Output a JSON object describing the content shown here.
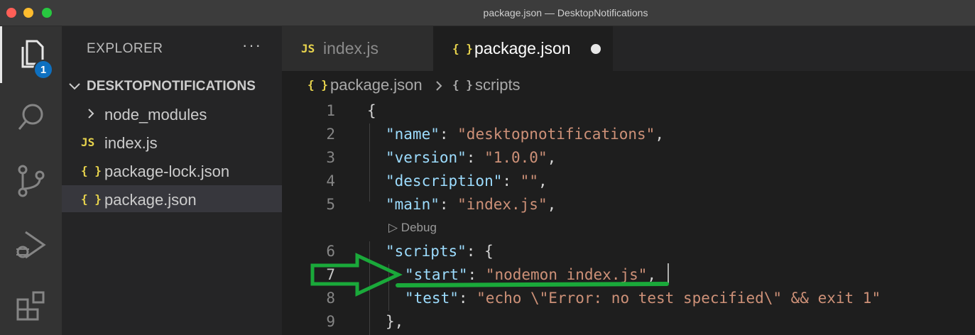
{
  "window": {
    "title": "package.json — DesktopNotifications"
  },
  "activity_bar": {
    "explorer_badge": "1"
  },
  "sidebar": {
    "header": "EXPLORER",
    "more": "···",
    "folder": "DESKTOPNOTIFICATIONS",
    "items": [
      {
        "icon": "JS",
        "label": "node_modules"
      },
      {
        "icon": "JS",
        "label": "index.js"
      },
      {
        "icon": "{ }",
        "label": "package-lock.json"
      },
      {
        "icon": "{ }",
        "label": "package.json"
      }
    ]
  },
  "tabs": [
    {
      "icon": "JS",
      "label": "index.js"
    },
    {
      "icon": "{ }",
      "label": "package.json"
    }
  ],
  "breadcrumb": {
    "icon1": "{ }",
    "file": "package.json",
    "icon2": "{ }",
    "section": "scripts"
  },
  "code": {
    "line_numbers": [
      "1",
      "2",
      "3",
      "4",
      "5",
      "6",
      "7",
      "8",
      "9"
    ],
    "codelens": "▷ Debug",
    "l1": "{",
    "l2_key": "\"name\"",
    "l2_sep": ": ",
    "l2_val": "\"desktopnotifications\"",
    "l2_end": ",",
    "l3_key": "\"version\"",
    "l3_sep": ": ",
    "l3_val": "\"1.0.0\"",
    "l3_end": ",",
    "l4_key": "\"description\"",
    "l4_sep": ": ",
    "l4_val": "\"\"",
    "l4_end": ",",
    "l5_key": "\"main\"",
    "l5_sep": ": ",
    "l5_val": "\"index.js\"",
    "l5_end": ",",
    "l6_key": "\"scripts\"",
    "l6_sep": ": {",
    "l7_key": "\"start\"",
    "l7_sep": ": ",
    "l7_val": "\"nodemon index.js\"",
    "l7_end": ",",
    "l8_key": "\"test\"",
    "l8_sep": ": ",
    "l8_val": "\"echo \\\"Error: no test specified\\\" && exit 1\"",
    "l9": "},"
  },
  "colors": {
    "annotation": "#1aa93a",
    "badge": "#0e70c0",
    "json_icon": "#e8d44d"
  }
}
